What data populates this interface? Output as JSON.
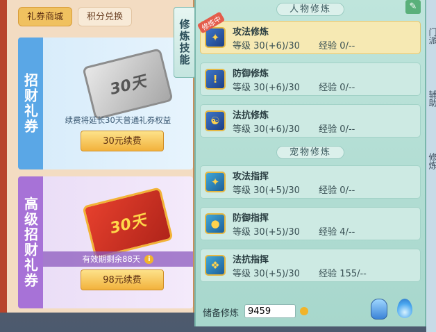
{
  "shop": {
    "tabs": [
      "礼券商城",
      "积分兑换"
    ],
    "cards": [
      {
        "title": "招财礼券",
        "coupon_text": "30天",
        "description": "续费将延长30天普通礼券权益",
        "button": "30元续费"
      },
      {
        "title": "高级招财礼券",
        "coupon_text": "30天",
        "description": "有效期剩余88天",
        "button": "98元续费"
      }
    ]
  },
  "side_label": "修炼技能",
  "training": {
    "character_section": "人物修炼",
    "pet_section": "宠物修炼",
    "level_label": "等级",
    "exp_label": "经验",
    "active_badge": "修炼中",
    "character_rows": [
      {
        "name": "攻法修炼",
        "level": "30(+6)/30",
        "exp": "0/--"
      },
      {
        "name": "防御修炼",
        "level": "30(+6)/30",
        "exp": "0/--"
      },
      {
        "name": "法抗修炼",
        "level": "30(+6)/30",
        "exp": "0/--"
      }
    ],
    "pet_rows": [
      {
        "name": "攻法指挥",
        "level": "30(+5)/30",
        "exp": "0/--"
      },
      {
        "name": "防御指挥",
        "level": "30(+5)/30",
        "exp": "4/--"
      },
      {
        "name": "法抗指挥",
        "level": "30(+5)/30",
        "exp": "155/--"
      }
    ],
    "reserve_label": "储备修炼",
    "reserve_value": "9459"
  },
  "right_strip": [
    "门派",
    "辅助",
    "修炼"
  ],
  "colors": {
    "accent_gold": "#f2b23c",
    "panel_teal": "#bfe5dc",
    "active_row": "#f6e9b3"
  }
}
